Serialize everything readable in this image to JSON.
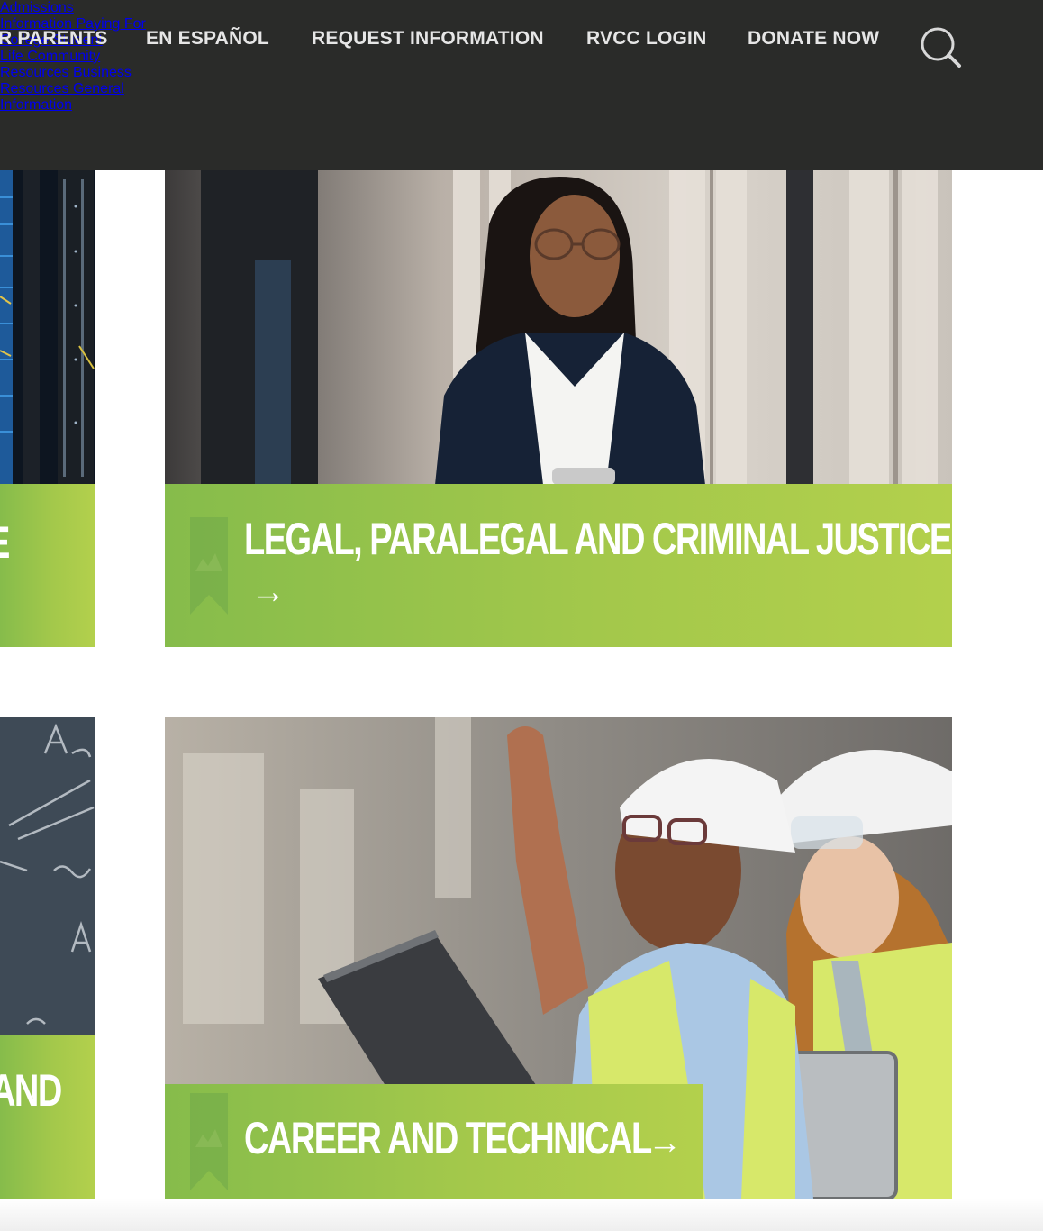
{
  "utility_nav": [
    {
      "label": "R PARENTS"
    },
    {
      "label": "EN ESPAÑOL"
    },
    {
      "label": "REQUEST INFORMATION"
    },
    {
      "label": "RVCC LOGIN"
    },
    {
      "label": "DONATE NOW"
    }
  ],
  "search": {
    "icon": "search-icon"
  },
  "main_nav": [
    {
      "line1": "Admissions",
      "line2": "Information"
    },
    {
      "line1": "Paying For",
      "line2": "College"
    },
    {
      "line1": "Student",
      "line2": "Life"
    },
    {
      "line1": "Community",
      "line2": "Resources"
    },
    {
      "line1": "Business",
      "line2": "Resources"
    },
    {
      "line1": "General",
      "line2": "Information"
    }
  ],
  "cards": {
    "left_top": {
      "title_fragment": "E"
    },
    "legal": {
      "title": "LEGAL, PARALEGAL AND CRIMINAL JUSTICE",
      "arrow": "→"
    },
    "left_bottom": {
      "title_fragment": "AND"
    },
    "career": {
      "title": "CAREER AND TECHNICAL",
      "arrow": "→"
    }
  },
  "colors": {
    "header_bg": "#2a2b29",
    "accent_green": "#a3c84b",
    "banner_text": "#ffffff"
  }
}
